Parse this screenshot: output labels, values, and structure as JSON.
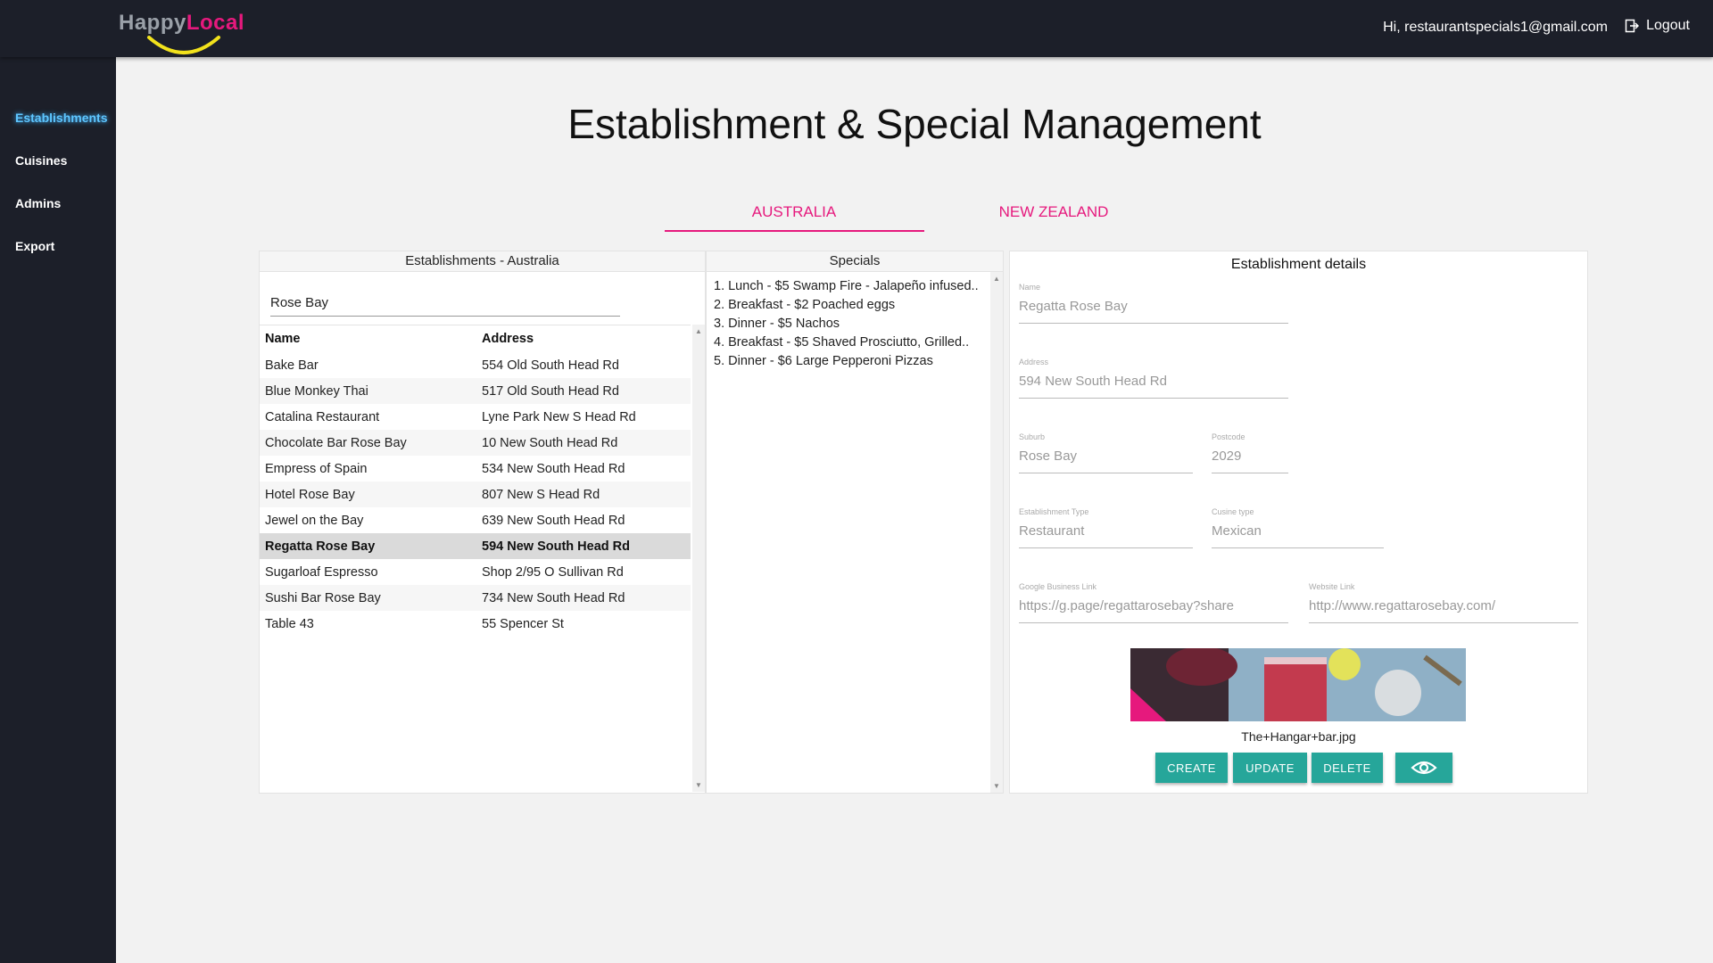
{
  "header": {
    "logo_happy": "Happy",
    "logo_local": "Local",
    "greeting": "Hi, restaurantspecials1@gmail.com",
    "logout_label": "Logout"
  },
  "sidebar": {
    "items": [
      {
        "label": "Establishments",
        "active": true
      },
      {
        "label": "Cuisines",
        "active": false
      },
      {
        "label": "Admins",
        "active": false
      },
      {
        "label": "Export",
        "active": false
      }
    ]
  },
  "page": {
    "title": "Establishment & Special Management",
    "tabs": [
      {
        "label": "AUSTRALIA",
        "selected": true
      },
      {
        "label": "NEW ZEALAND",
        "selected": false
      }
    ]
  },
  "establishments": {
    "header": "Establishments - Australia",
    "search_value": "Rose Bay",
    "columns": [
      "Name",
      "Address"
    ],
    "rows": [
      {
        "name": "Bake Bar",
        "address": "554 Old South Head Rd"
      },
      {
        "name": "Blue Monkey Thai",
        "address": "517 Old South Head Rd"
      },
      {
        "name": "Catalina Restaurant",
        "address": "Lyne Park New S Head Rd"
      },
      {
        "name": "Chocolate Bar Rose Bay",
        "address": "10 New South Head Rd"
      },
      {
        "name": "Empress of Spain",
        "address": "534 New South Head Rd"
      },
      {
        "name": "Hotel Rose Bay",
        "address": "807 New S Head Rd"
      },
      {
        "name": "Jewel on the Bay",
        "address": "639 New South Head Rd"
      },
      {
        "name": "Regatta Rose Bay",
        "address": "594 New South Head Rd"
      },
      {
        "name": "Sugarloaf Espresso",
        "address": "Shop 2/95 O Sullivan Rd"
      },
      {
        "name": "Sushi Bar Rose Bay",
        "address": "734 New South Head Rd"
      },
      {
        "name": "Table 43",
        "address": "55 Spencer St"
      }
    ],
    "selected_index": 7
  },
  "specials": {
    "header": "Specials",
    "items": [
      "1. Lunch - $5 Swamp Fire - Jalapeño infused..",
      "2. Breakfast - $2 Poached eggs",
      "3. Dinner - $5 Nachos",
      "4. Breakfast - $5 Shaved Prosciutto, Grilled..",
      "5. Dinner - $6 Large Pepperoni Pizzas"
    ]
  },
  "details": {
    "title": "Establishment details",
    "name": {
      "label": "Name",
      "value": "Regatta Rose Bay"
    },
    "address": {
      "label": "Address",
      "value": "594 New South Head Rd"
    },
    "suburb": {
      "label": "Suburb",
      "value": "Rose Bay"
    },
    "postcode": {
      "label": "Postcode",
      "value": "2029"
    },
    "establishment_type": {
      "label": "Establishment Type",
      "value": "Restaurant"
    },
    "cuisine_type": {
      "label": "Cusine type",
      "value": "Mexican"
    },
    "google_link": {
      "label": "Google Business Link",
      "value": "https://g.page/regattarosebay?share"
    },
    "website_link": {
      "label": "Website Link",
      "value": "http://www.regattarosebay.com/"
    },
    "image_filename": "The+Hangar+bar.jpg",
    "buttons": {
      "create": "CREATE",
      "update": "UPDATE",
      "delete": "DELETE"
    }
  },
  "colors": {
    "accent": "#e6197d",
    "button": "#26a69a",
    "nav_bg": "#1c1f29",
    "active_nav": "#5ec6ff"
  },
  "icons": {
    "logout": "logout-icon",
    "view": "eye-icon"
  }
}
